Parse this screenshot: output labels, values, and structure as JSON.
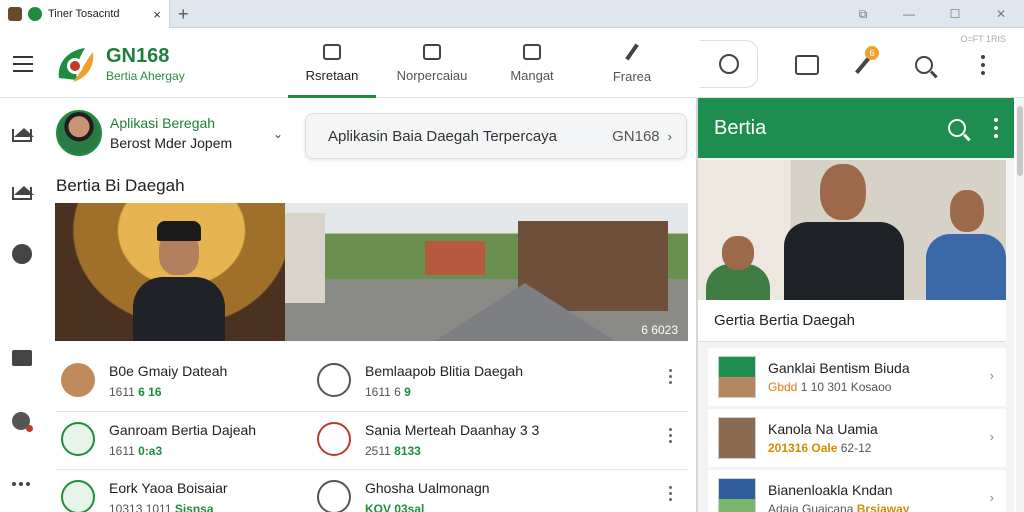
{
  "browser": {
    "tab_title": "Tiner Tosacntd",
    "tab_close": "×",
    "new_tab": "+"
  },
  "header": {
    "brand_title": "GN168",
    "brand_subtitle": "Bertia Ahergay",
    "corner_tag": "O=FT 1RIS",
    "notification_count": "6",
    "nav": [
      {
        "label": "Rsretaan",
        "icon": "home-icon"
      },
      {
        "label": "Norpercaiau",
        "icon": "edit-icon"
      },
      {
        "label": "Mangat",
        "icon": "mail-icon"
      },
      {
        "label": "Frarea",
        "icon": "pen-icon"
      }
    ]
  },
  "profile": {
    "name": "Aplikasi Beregah",
    "subtitle": "Berost Mder Jopem"
  },
  "search": {
    "text": "Aplikasin Baia Daegah Terpercaya",
    "code": "GN168",
    "chevron": "›"
  },
  "section_title": "Bertia Bi Daegah",
  "hero_code": "6 6023",
  "list": [
    {
      "title": "B0e Gmaiy Dateah",
      "meta_prefix": "1611 ",
      "meta_highlight": "6 16",
      "icon": "avatar-icon"
    },
    {
      "title": "Bemlaapob Blitia Daegah",
      "meta_prefix": "1611 6 ",
      "meta_highlight": "9",
      "icon": "star-icon"
    },
    {
      "title": "Ganroam Bertia Dajeah",
      "meta_prefix": "1611 ",
      "meta_highlight": "0:a3",
      "icon": "user-icon"
    },
    {
      "title": "Sania Merteah Daanhay 3 3",
      "meta_prefix": "2511 ",
      "meta_highlight": "8133",
      "icon": "heart-icon"
    },
    {
      "title": "Eork Yaoa Boisaiar",
      "meta_prefix": "10313 1011 ",
      "meta_highlight": "Sisnsa",
      "icon": "check-icon"
    },
    {
      "title": "Ghosha Ualmonagn",
      "meta_prefix": "",
      "meta_highlight": "KOV 03sal",
      "icon": "clock-icon"
    }
  ],
  "right_panel": {
    "title": "Bertia",
    "caption": "Gertia Bertia Daegah",
    "items": [
      {
        "title": "Ganklai Bentism Biuda",
        "meta_strong": "Gbdd",
        "meta_rest": " 1 10 301 Kosaoo"
      },
      {
        "title": "Kanola Na Uamia",
        "meta_strong": "201316 Oale",
        "meta_rest": " 62-12"
      },
      {
        "title": "Bianenloakla Kndan",
        "meta_strong": "Brsjaway",
        "meta_rest": "Adaia  Guaicana"
      }
    ]
  },
  "colors": {
    "accent": "#1e8e3e",
    "panel_header": "#1e8e4e",
    "notification": "#f0a030"
  }
}
